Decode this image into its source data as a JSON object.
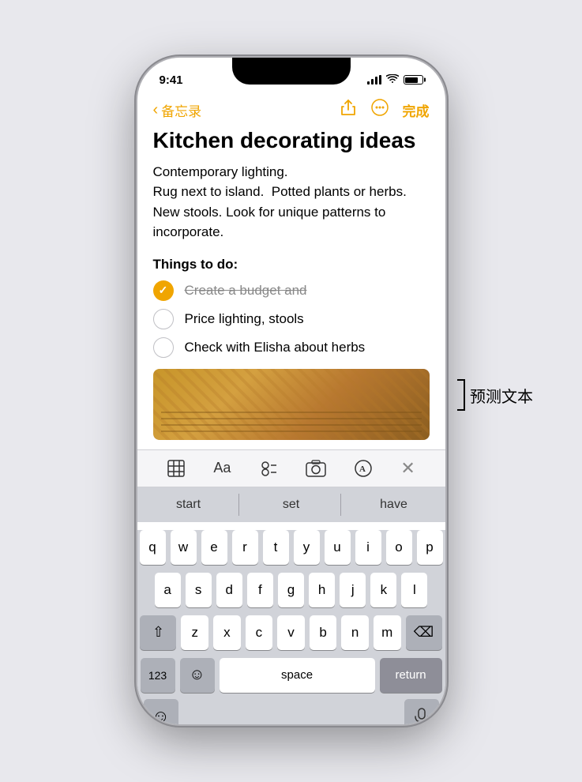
{
  "status_bar": {
    "time": "9:41"
  },
  "nav": {
    "back_label": "备忘录",
    "done_label": "完成"
  },
  "note": {
    "title": "Kitchen decorating ideas",
    "body": "Contemporary lighting.\nRug next to island.  Potted plants or herbs.\nNew stools. Look for unique patterns to incorporate.",
    "section_label": "Things to do:",
    "checklist": [
      {
        "checked": true,
        "text": "Create a budget and"
      },
      {
        "checked": false,
        "text": "Price lighting, stools"
      },
      {
        "checked": false,
        "text": "Check with Elisha about herbs"
      }
    ]
  },
  "toolbar": {
    "table_icon": "⊞",
    "text_icon": "Aa",
    "list_icon": "≡",
    "camera_icon": "⊙",
    "format_icon": "Ⓐ",
    "close_icon": "×"
  },
  "predictive": {
    "words": [
      "start",
      "set",
      "have"
    ]
  },
  "keyboard": {
    "rows": [
      [
        "q",
        "w",
        "e",
        "r",
        "t",
        "y",
        "u",
        "i",
        "o",
        "p"
      ],
      [
        "a",
        "s",
        "d",
        "f",
        "g",
        "h",
        "j",
        "k",
        "l"
      ],
      [
        "z",
        "x",
        "c",
        "v",
        "b",
        "n",
        "m"
      ]
    ],
    "numbers_label": "123",
    "space_label": "space",
    "return_label": "return",
    "shift_icon": "⇧",
    "backspace_icon": "⌫",
    "emoji_icon": "☺",
    "dictate_icon": "🎤"
  },
  "annotation": {
    "text": "预测文本"
  }
}
